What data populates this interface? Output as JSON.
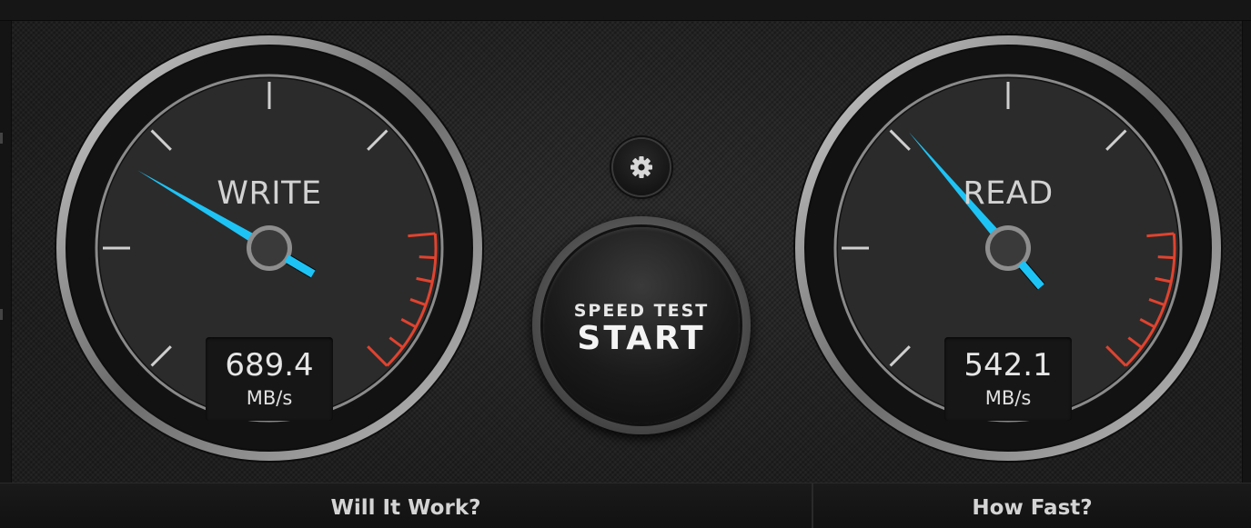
{
  "gauges": {
    "write": {
      "label": "WRITE",
      "value": "689.4",
      "unit": "MB/s",
      "needle_fraction": 0.28
    },
    "read": {
      "label": "READ",
      "value": "542.1",
      "unit": "MB/s",
      "needle_fraction": 0.35
    }
  },
  "start_button": {
    "top_label": "SPEED TEST",
    "main_label": "START"
  },
  "settings": {
    "icon": "gear-icon"
  },
  "bottom_bar": {
    "will_it_work": "Will It Work?",
    "how_fast": "How Fast?"
  },
  "colors": {
    "needle": "#1ec3f5",
    "redline": "#e0432f",
    "tick": "#cfcfcf"
  }
}
